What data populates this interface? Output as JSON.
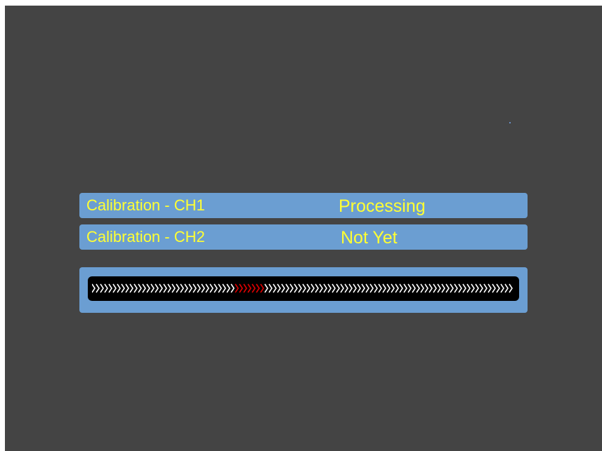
{
  "calibration": {
    "rows": [
      {
        "label": "Calibration - CH1",
        "status": "Processing"
      },
      {
        "label": "Calibration - CH2",
        "status": "Not Yet"
      }
    ]
  },
  "progress": {
    "chevron_count": 100,
    "active_start": 34,
    "active_count": 7,
    "icon": "chevron-right-icon"
  },
  "colors": {
    "background": "#444444",
    "panel": "#6b9ed2",
    "text": "#ffff33",
    "track": "#000000",
    "chevron": "#ffffff",
    "chevron_active": "#e00000"
  }
}
